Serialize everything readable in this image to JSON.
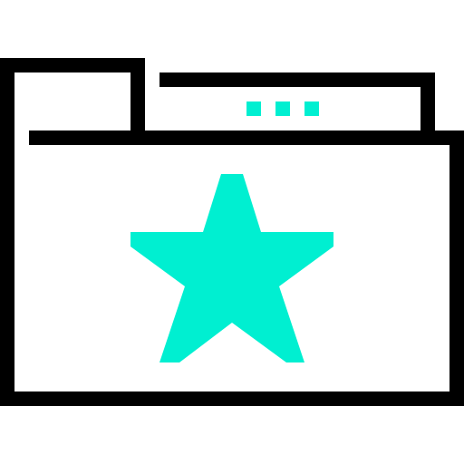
{
  "icon": {
    "name": "favorite-folder-icon",
    "outline_color": "#000000",
    "accent_color": "#00efd1",
    "background_color": "#ffffff",
    "parts": {
      "folder": "folder-outline-icon",
      "star": "star-icon",
      "dots": "ellipsis-dots-icon"
    },
    "dot_count": 3
  }
}
